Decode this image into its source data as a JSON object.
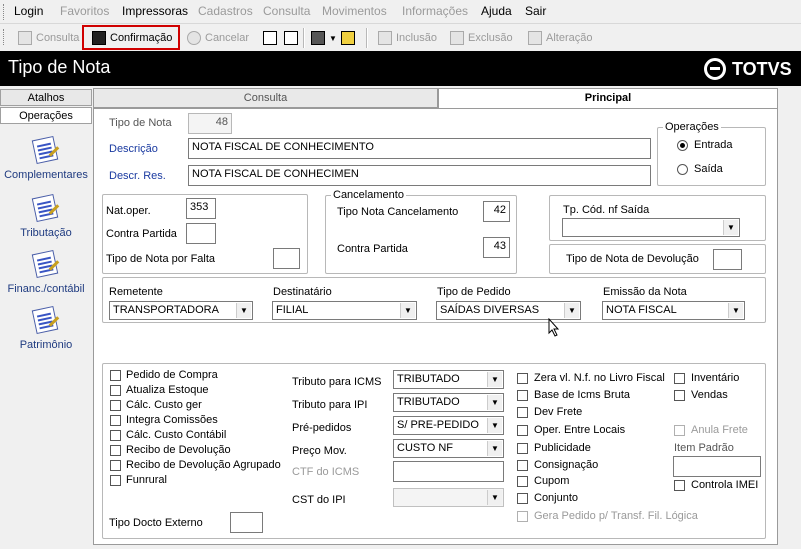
{
  "menu": {
    "items": [
      {
        "label": "Login",
        "enabled": true
      },
      {
        "label": "Favoritos",
        "enabled": false
      },
      {
        "label": "Impressoras",
        "enabled": true
      },
      {
        "label": "Cadastros",
        "enabled": false
      },
      {
        "label": "Consulta",
        "enabled": false
      },
      {
        "label": "Movimentos",
        "enabled": false
      },
      {
        "label": "Informações",
        "enabled": false
      },
      {
        "label": "Ajuda",
        "enabled": true
      },
      {
        "label": "Sair",
        "enabled": true
      }
    ]
  },
  "toolbar": {
    "consulta": "Consulta",
    "confirmacao": "Confirmação",
    "cancelar": "Cancelar",
    "inclusao": "Inclusão",
    "exclusao": "Exclusão",
    "alteracao": "Alteração",
    "highlight_color": "#d00000"
  },
  "titlebar": {
    "title": "Tipo de Nota",
    "brand": "TOTVS"
  },
  "sidebar": {
    "tabs": [
      "Atalhos",
      "Operações"
    ],
    "items": [
      {
        "label": "Complementares",
        "icon": "document-pen-icon"
      },
      {
        "label": "Tributação",
        "icon": "document-pen-icon"
      },
      {
        "label": "Financ./contábil",
        "icon": "document-pen-icon"
      },
      {
        "label": "Patrimônio",
        "icon": "document-pen-icon"
      }
    ]
  },
  "tabs": {
    "consulta": "Consulta",
    "principal": "Principal"
  },
  "form": {
    "tipo_de_nota_label": "Tipo de Nota",
    "tipo_de_nota_value": "48",
    "descricao_label": "Descrição",
    "descricao_value": "NOTA FISCAL DE CONHECIMENTO",
    "descr_res_label": "Descr. Res.",
    "descr_res_value": "NOTA FISCAL DE CONHECIMEN",
    "operacoes_title": "Operações",
    "entrada": "Entrada",
    "saida": "Saída",
    "nat_oper_label": "Nat.oper.",
    "nat_oper_value": "353",
    "contra_partida_label": "Contra Partida",
    "tipo_nota_falta_label": "Tipo de Nota por Falta",
    "cancelamento_title": "Cancelamento",
    "tipo_nota_cancel_label": "Tipo Nota Cancelamento",
    "tipo_nota_cancel_value": "42",
    "cancel_contra_partida_label": "Contra Partida",
    "cancel_contra_partida_value": "43",
    "tp_cod_nf_saida_label": "Tp. Cód. nf Saída",
    "tipo_nota_devolucao_label": "Tipo de Nota de Devolução",
    "remetente_label": "Remetente",
    "remetente_value": "TRANSPORTADORA",
    "destinatario_label": "Destinatário",
    "destinatario_value": "FILIAL",
    "tipo_pedido_label": "Tipo de Pedido",
    "tipo_pedido_value": "SAÍDAS DIVERSAS",
    "emissao_nota_label": "Emissão da Nota",
    "emissao_nota_value": "NOTA FISCAL"
  },
  "checks_left": [
    "Pedido de Compra",
    "Atualiza Estoque",
    "Cálc. Custo ger",
    "Integra Comissões",
    "Cálc. Custo Contábil",
    "Recibo de Devolução",
    "Recibo de Devolução Agrupado",
    "Funrural"
  ],
  "tributos": {
    "icms_label": "Tributo para ICMS",
    "icms_value": "TRIBUTADO",
    "ipi_label": "Tributo para IPI",
    "ipi_value": "TRIBUTADO",
    "prepedidos_label": "Pré-pedidos",
    "prepedidos_value": "S/ PRE-PEDIDO",
    "preco_label": "Preço Mov.",
    "preco_value": "CUSTO NF",
    "ctf_label": "CTF do ICMS",
    "cst_label": "CST do IPI"
  },
  "checks_mid": [
    "Zera vl. N.f. no Livro Fiscal",
    "Base de Icms Bruta",
    "Dev Frete",
    "Oper. Entre Locais",
    "Publicidade",
    "Consignação",
    "Cupom",
    "Conjunto"
  ],
  "gera_pedido": "Gera Pedido p/ Transf. Fil. Lógica",
  "checks_right": {
    "inventario": "Inventário",
    "vendas": "Vendas",
    "anula_frete": "Anula Frete",
    "item_padrao": "Item Padrão",
    "controla_imei": "Controla IMEI"
  },
  "tipo_docto_externo_label": "Tipo Docto Externo"
}
